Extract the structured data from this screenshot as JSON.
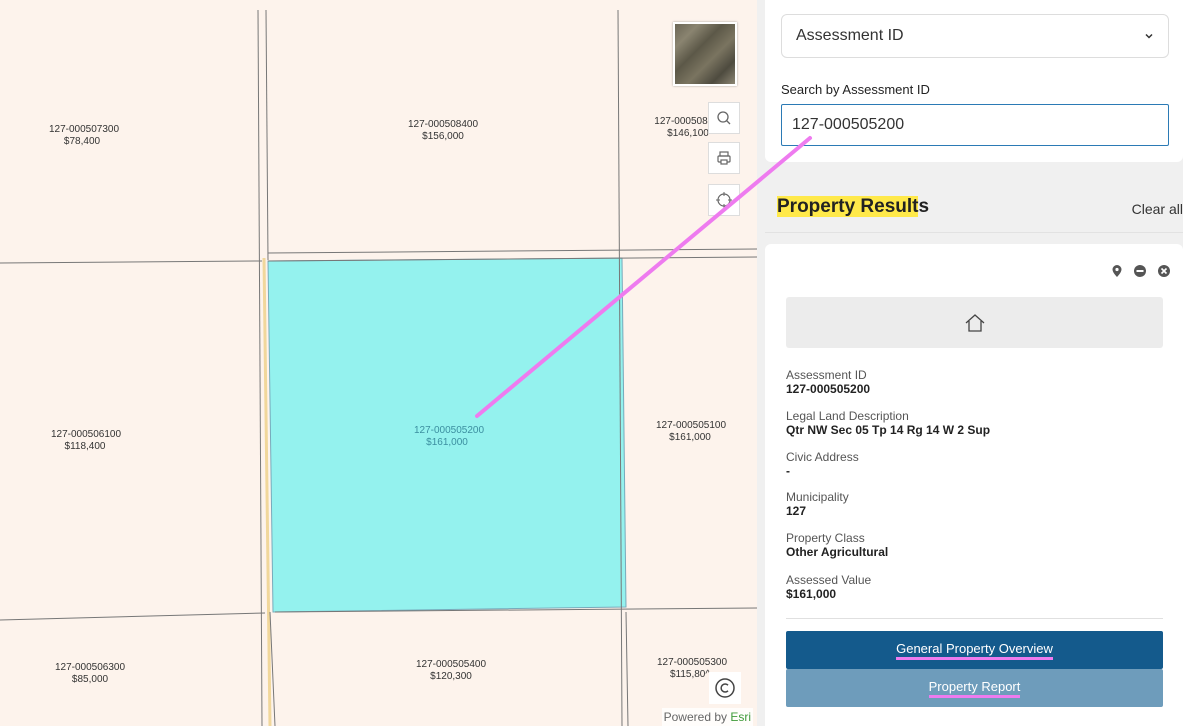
{
  "map": {
    "parcels": [
      {
        "id": "127-000507300",
        "value": "$78,400"
      },
      {
        "id": "127-000508400",
        "value": "$156,000"
      },
      {
        "id": "127-000508",
        "value": "$146,100"
      },
      {
        "id": "127-000506100",
        "value": "$118,400"
      },
      {
        "id": "127-000505200",
        "value": "$161,000"
      },
      {
        "id": "127-000505100",
        "value": "$161,000"
      },
      {
        "id": "127-000506300",
        "value": "$85,000"
      },
      {
        "id": "127-000505400",
        "value": "$120,300"
      },
      {
        "id": "127-000505300",
        "value": "$115,80^"
      }
    ],
    "selected_parcel": "127-000505200",
    "selected_color": "#94f2ee",
    "attribution_prefix": "Powered by ",
    "attribution_brand": "Esri",
    "icons": {
      "zoom": "search-icon",
      "print": "print-icon",
      "locate": "locate-icon",
      "copyright": "copyright-icon",
      "basemap": "basemap-thumbnail"
    }
  },
  "search": {
    "type_select": "Assessment ID",
    "label": "Search by Assessment ID",
    "value": "127-000505200"
  },
  "results": {
    "title_highlighted": "Property Result",
    "title_rest": "s",
    "clear_all": "Clear all",
    "card": {
      "fields": [
        {
          "label": "Assessment ID",
          "value": "127-000505200"
        },
        {
          "label": "Legal Land Description",
          "value": "Qtr NW Sec 05 Tp 14 Rg 14 W 2 Sup"
        },
        {
          "label": "Civic Address",
          "value": "-"
        },
        {
          "label": "Municipality",
          "value": "127"
        },
        {
          "label": "Property Class",
          "value": "Other Agricultural"
        },
        {
          "label": "Assessed Value",
          "value": "$161,000"
        }
      ],
      "general_overview_button": "General Property Overview",
      "report_button": "Property Report"
    }
  },
  "colors": {
    "primary_button": "#145a8c",
    "secondary_button": "#6e9cbb",
    "highlight": "#ffe94a",
    "annotation": "#ee7bef"
  }
}
